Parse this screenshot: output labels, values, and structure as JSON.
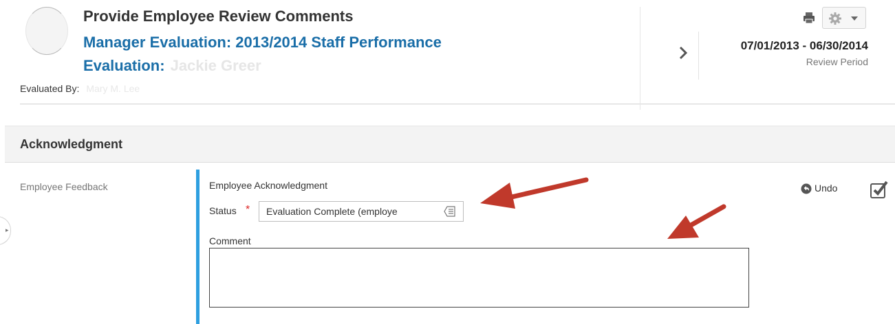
{
  "header": {
    "page_title": "Provide Employee Review Comments",
    "evaluation_title": "Manager Evaluation: 2013/2014 Staff Performance Evaluation:",
    "employee_name": "Jackie Greer",
    "evaluated_by_label": "Evaluated By:",
    "evaluated_by_value": "Mary M. Lee",
    "review_period_dates": "07/01/2013 - 06/30/2014",
    "review_period_label": "Review Period",
    "toolbar_icons": [
      "print-icon",
      "gear-icon",
      "caret-down-icon"
    ],
    "next_icon": "chevron-right-icon"
  },
  "section": {
    "title": "Acknowledgment"
  },
  "form": {
    "left_label": "Employee Feedback",
    "group_label": "Employee Acknowledgment",
    "status_label": "Status",
    "required_marker": "*",
    "status_value": "Evaluation Complete (employe",
    "comment_label": "Comment",
    "comment_value": "",
    "undo_label": "Undo"
  },
  "colors": {
    "link_blue": "#1a6ea8",
    "accent_bar": "#2e9fe0",
    "annotation_arrow": "#c0392b",
    "required": "#dd2222"
  }
}
